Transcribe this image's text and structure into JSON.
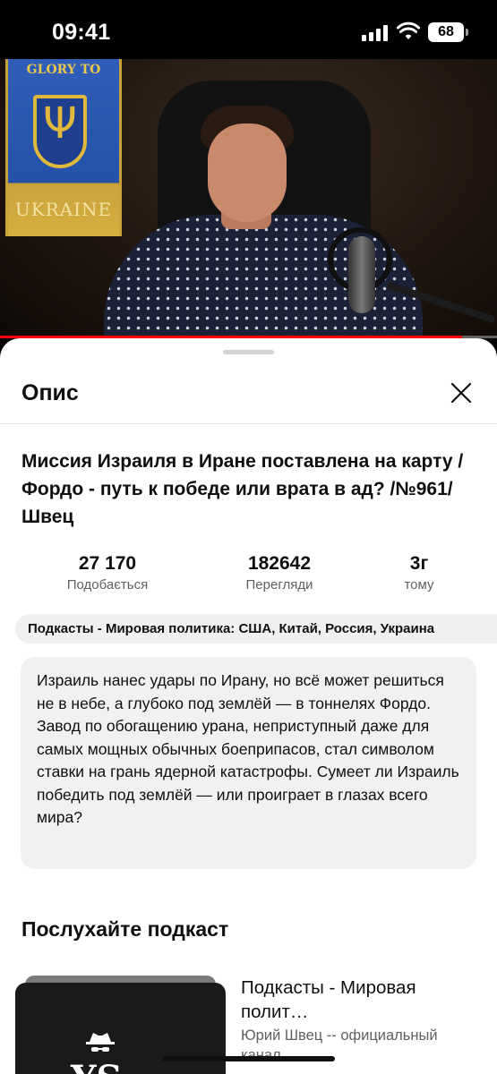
{
  "status_bar": {
    "time": "09:41",
    "battery": "68"
  },
  "video": {
    "flag_top_text": "GLORY TO",
    "flag_bottom_text": "UKRAINE",
    "progress_fraction": 0.93,
    "progress_color": "#ff0000"
  },
  "sheet": {
    "title": "Опис",
    "video_title": "Миссия Израиля в Иране поставлена на карту / Фордо - путь к победе или врата в ад? /№961/ Швец",
    "stats": [
      {
        "value": "27 170",
        "label": "Подобається"
      },
      {
        "value": "182642",
        "label": "Перегляди"
      },
      {
        "value": "3г",
        "label": "тому"
      }
    ],
    "playlist_chip": "Подкасты - Мировая политика: США, Китай, Россия, Украина",
    "description": "Израиль нанес удары по Ирану, но всё может решиться не в небе, а глубоко под землёй — в тоннелях Фордо. Завод по обогащению урана, неприступный даже для самых мощных обычных боеприпасов, стал символом ставки на грань ядерной катастрофы. Сумеет ли Израиль победить под землёй — или проиграет в глазах всего мира?",
    "podcast_section_title": "Послухайте подкаст",
    "podcast": {
      "thumb_text": "YS",
      "name": "Подкасты - Мировая полит…",
      "author": "Юрий Швец -- официальный канал"
    }
  },
  "icons": {
    "close": "close-icon",
    "signal": "signal-icon",
    "wifi": "wifi-icon",
    "battery": "battery-icon",
    "spy": "spy-icon"
  },
  "colors": {
    "accent_red": "#ff0000",
    "secondary_text": "#606060",
    "chip_bg": "#f0f0f0",
    "description_bg": "#f1f1f1"
  }
}
